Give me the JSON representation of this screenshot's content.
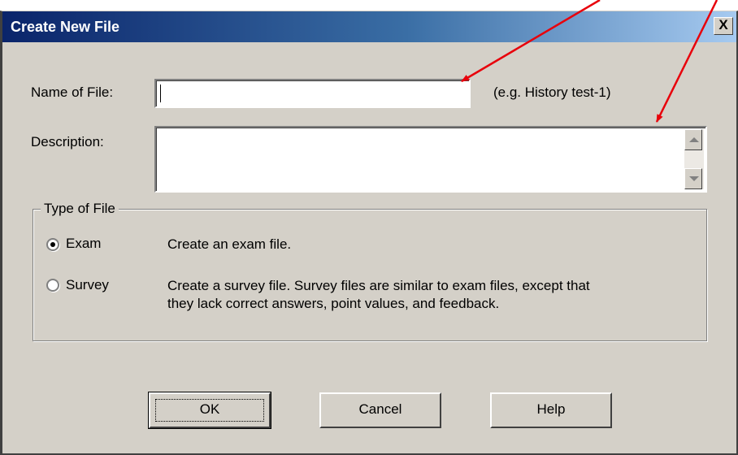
{
  "window": {
    "title": "Create New File",
    "close_symbol": "X"
  },
  "form": {
    "name_label": "Name of File:",
    "name_value": "",
    "name_hint": "(e.g. History test-1)",
    "description_label": "Description:",
    "description_value": ""
  },
  "file_type": {
    "group_label": "Type of File",
    "options": [
      {
        "label": "Exam",
        "selected": true,
        "description": "Create an exam file."
      },
      {
        "label": "Survey",
        "selected": false,
        "description_line1": "Create a survey file.  Survey files are similar to exam files, except that",
        "description_line2": "they lack correct answers, point values, and feedback."
      }
    ]
  },
  "buttons": {
    "ok": "OK",
    "cancel": "Cancel",
    "help": "Help"
  },
  "annotation": {
    "arrow_color": "#e8000b"
  },
  "icons": {
    "close": "close-icon",
    "scroll_up": "chevron-up-icon",
    "scroll_down": "chevron-down-icon"
  }
}
